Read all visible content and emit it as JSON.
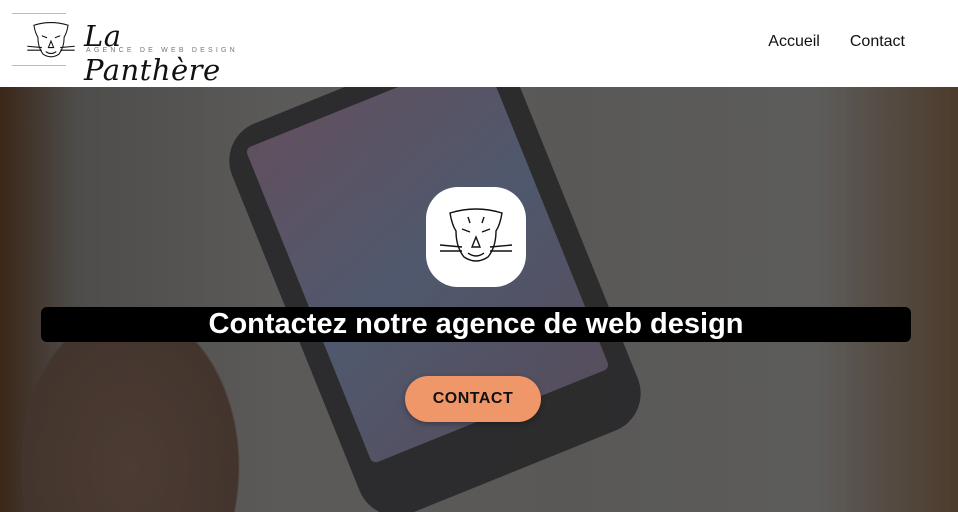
{
  "header": {
    "brand": "La Panthère",
    "tagline": "AGENCE DE WEB DESIGN",
    "nav": [
      {
        "label": "Accueil"
      },
      {
        "label": "Contact"
      }
    ]
  },
  "hero": {
    "title": "Contactez notre agence de web design",
    "cta_label": "CONTACT",
    "cta_color": "#f0976a",
    "logo_icon": "panther-head-icon"
  }
}
